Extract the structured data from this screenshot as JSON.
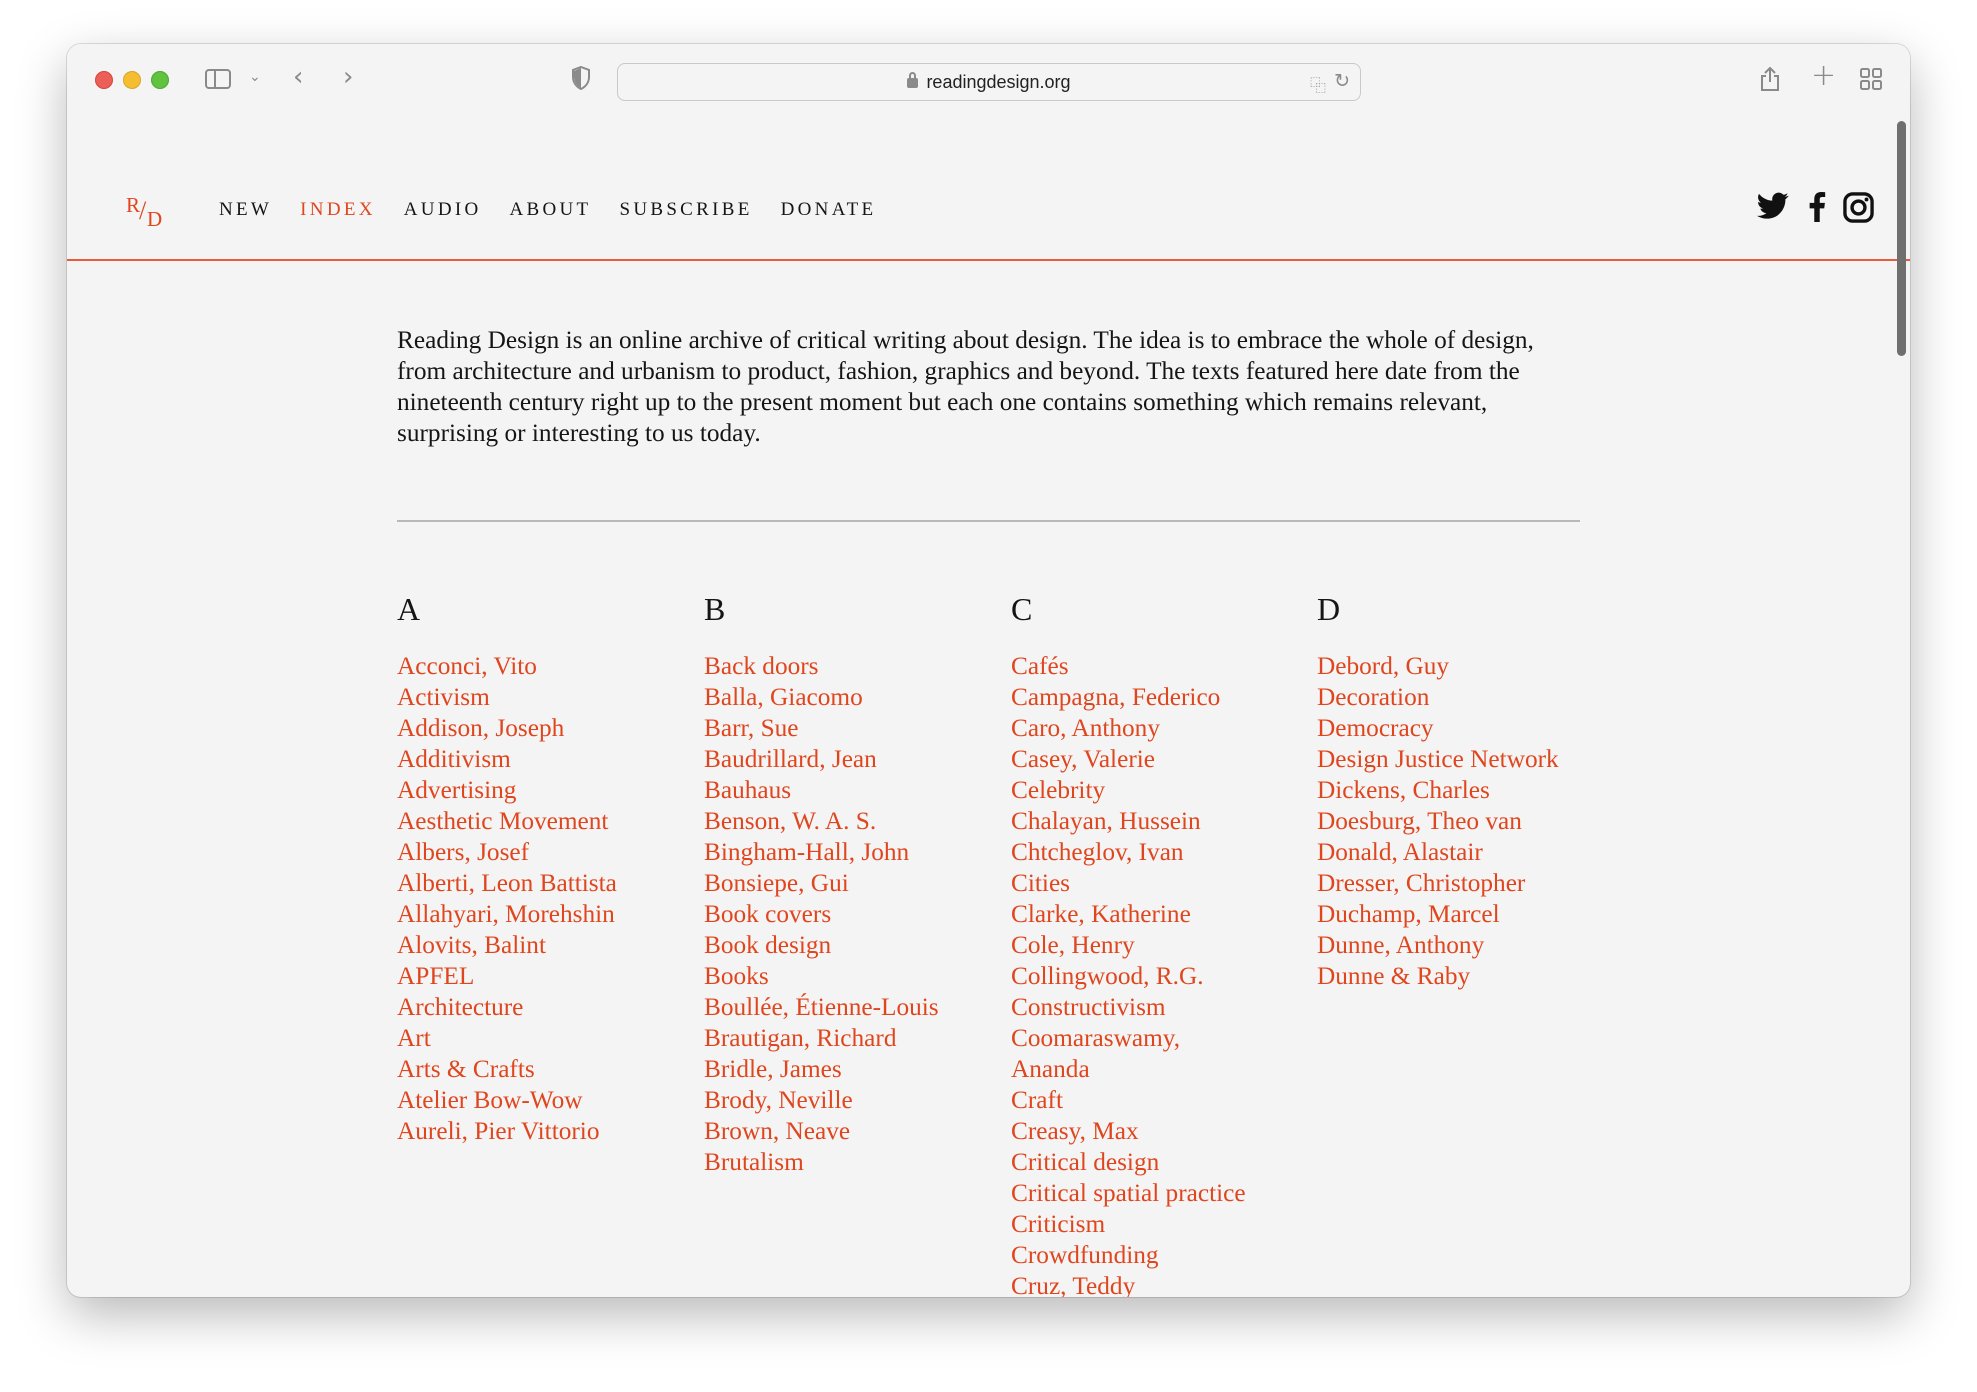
{
  "browser": {
    "url": "readingdesign.org"
  },
  "site": {
    "logo": {
      "r": "R",
      "slash": "/",
      "d": "D"
    },
    "nav": [
      {
        "label": "NEW",
        "active": false
      },
      {
        "label": "INDEX",
        "active": true
      },
      {
        "label": "AUDIO",
        "active": false
      },
      {
        "label": "ABOUT",
        "active": false
      },
      {
        "label": "SUBSCRIBE",
        "active": false
      },
      {
        "label": "DONATE",
        "active": false
      }
    ],
    "social": [
      "twitter-icon",
      "facebook-icon",
      "instagram-icon"
    ]
  },
  "intro": "Reading Design is an online archive of critical writing about design. The idea is to embrace the whole of design, from architecture and urbanism to product, fashion, graphics and beyond. The texts featured here date from the nineteenth century right up to the present moment but each one contains something which remains relevant, surprising or interesting to us today.",
  "index": {
    "A": {
      "letter": "A",
      "items": [
        "Acconci, Vito",
        "Activism",
        "Addison, Joseph",
        "Additivism",
        "Advertising",
        "Aesthetic Movement",
        "Albers, Josef",
        "Alberti, Leon Battista",
        "Allahyari, Morehshin",
        "Alovits, Balint",
        "APFEL",
        "Architecture",
        "Art",
        "Arts & Crafts",
        "Atelier Bow-Wow",
        "Aureli, Pier Vittorio"
      ]
    },
    "B": {
      "letter": "B",
      "items": [
        "Back doors",
        "Balla, Giacomo",
        "Barr, Sue",
        "Baudrillard, Jean",
        "Bauhaus",
        "Benson, W. A. S.",
        "Bingham-Hall, John",
        "Bonsiepe, Gui",
        "Book covers",
        "Book design",
        "Books",
        "Boullée, Étienne-Louis",
        "Brautigan, Richard",
        "Bridle, James",
        "Brody, Neville",
        "Brown, Neave",
        "Brutalism"
      ]
    },
    "C": {
      "letter": "C",
      "items": [
        "Cafés",
        "Campagna, Federico",
        "Caro, Anthony",
        "Casey, Valerie",
        "Celebrity",
        "Chalayan, Hussein",
        "Chtcheglov, Ivan",
        "Cities",
        "Clarke, Katherine",
        "Cole, Henry",
        "Collingwood, R.G.",
        "Constructivism",
        "Coomaraswamy, Ananda",
        "Craft",
        "Creasy, Max",
        "Critical design",
        "Critical spatial practice",
        "Criticism",
        "Crowdfunding",
        "Cruz, Teddy"
      ]
    },
    "D": {
      "letter": "D",
      "items": [
        "Debord, Guy",
        "Decoration",
        "Democracy",
        "Design Justice Network",
        "Dickens, Charles",
        "Doesburg, Theo van",
        "Donald, Alastair",
        "Dresser, Christopher",
        "Duchamp, Marcel",
        "Dunne, Anthony",
        "Dunne & Raby"
      ]
    }
  }
}
